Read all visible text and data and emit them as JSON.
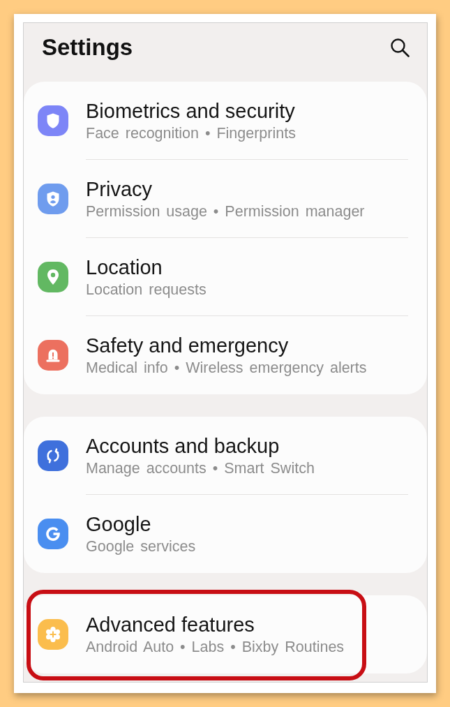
{
  "header": {
    "title": "Settings"
  },
  "groups": [
    {
      "items": [
        {
          "kind": "biometrics",
          "title": "Biometrics and security",
          "subtitle": "Face recognition • Fingerprints",
          "color": "#7d85f7",
          "highlighted": false
        },
        {
          "kind": "privacy",
          "title": "Privacy",
          "subtitle": "Permission usage • Permission manager",
          "color": "#6f9cee",
          "highlighted": false
        },
        {
          "kind": "location",
          "title": "Location",
          "subtitle": "Location requests",
          "color": "#62b862",
          "highlighted": false
        },
        {
          "kind": "safety",
          "title": "Safety and emergency",
          "subtitle": "Medical info • Wireless emergency alerts",
          "color": "#ec705f",
          "highlighted": false
        }
      ]
    },
    {
      "items": [
        {
          "kind": "accounts",
          "title": "Accounts and backup",
          "subtitle": "Manage accounts • Smart Switch",
          "color": "#3f70dc",
          "highlighted": false
        },
        {
          "kind": "google",
          "title": "Google",
          "subtitle": "Google services",
          "color": "#4a8ef0",
          "highlighted": false
        }
      ]
    },
    {
      "items": [
        {
          "kind": "advanced",
          "title": "Advanced features",
          "subtitle": "Android Auto • Labs • Bixby Routines",
          "color": "#fbbd4d",
          "highlighted": true
        }
      ]
    }
  ]
}
